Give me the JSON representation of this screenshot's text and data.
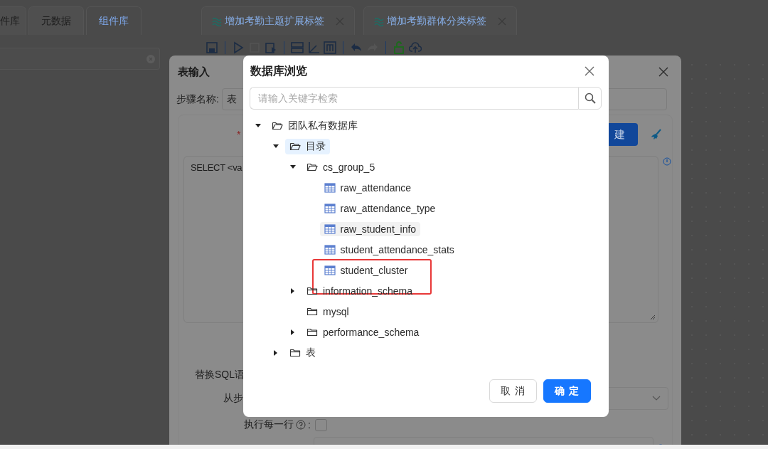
{
  "workspace": {
    "left_tabs": [
      {
        "label": "件库",
        "selected": false
      },
      {
        "label": "元数据",
        "selected": false
      },
      {
        "label": "组件库",
        "selected": true
      }
    ],
    "editor_tabs": [
      {
        "label": "增加考勤主题扩展标签"
      },
      {
        "label": "增加考勤群体分类标签"
      }
    ]
  },
  "step_dialog": {
    "title": "表输入",
    "step_name_label": "步骤名称:",
    "step_name_value": "表",
    "required_mark": "*",
    "new_button": "建",
    "sql_text": "SELECT <va",
    "replace_sql_label": "替换SQL语",
    "from_step_label": "从步",
    "each_row_label": "执行每一行",
    "each_row_colon": ":",
    "each_row_checked": false
  },
  "browser_dialog": {
    "title": "数据库浏览",
    "search": {
      "placeholder": "请输入关键字检索"
    },
    "tree": [
      {
        "label": "团队私有数据库",
        "kind": "folder",
        "expanded": true,
        "selected": false,
        "hovered": false,
        "highlighted": false,
        "children": [
          {
            "label": "目录",
            "kind": "folder",
            "expanded": true,
            "selected": true,
            "hovered": false,
            "highlighted": false,
            "children": [
              {
                "label": "cs_group_5",
                "kind": "folder",
                "expanded": true,
                "selected": false,
                "hovered": false,
                "highlighted": false,
                "children": [
                  {
                    "label": "raw_attendance",
                    "kind": "table",
                    "expanded": false,
                    "selected": false,
                    "hovered": false,
                    "highlighted": false
                  },
                  {
                    "label": "raw_attendance_type",
                    "kind": "table",
                    "expanded": false,
                    "selected": false,
                    "hovered": false,
                    "highlighted": false
                  },
                  {
                    "label": "raw_student_info",
                    "kind": "table",
                    "expanded": false,
                    "selected": false,
                    "hovered": true,
                    "highlighted": false
                  },
                  {
                    "label": "student_attendance_stats",
                    "kind": "table",
                    "expanded": false,
                    "selected": false,
                    "hovered": false,
                    "highlighted": false
                  },
                  {
                    "label": "student_cluster",
                    "kind": "table",
                    "expanded": false,
                    "selected": false,
                    "hovered": false,
                    "highlighted": true
                  }
                ]
              },
              {
                "label": "information_schema",
                "kind": "folder",
                "expanded": false,
                "selected": false,
                "hovered": false,
                "highlighted": false
              },
              {
                "label": "mysql",
                "kind": "empty_folder",
                "expanded": false,
                "selected": false,
                "hovered": false,
                "highlighted": false
              },
              {
                "label": "performance_schema",
                "kind": "folder",
                "expanded": false,
                "selected": false,
                "hovered": false,
                "highlighted": false
              }
            ]
          },
          {
            "label": "表",
            "kind": "folder",
            "expanded": false,
            "selected": false,
            "hovered": false,
            "highlighted": false
          }
        ]
      }
    ],
    "buttons": [
      {
        "label": "取 消",
        "kind": "default"
      },
      {
        "label": "确 定",
        "kind": "primary"
      }
    ]
  }
}
